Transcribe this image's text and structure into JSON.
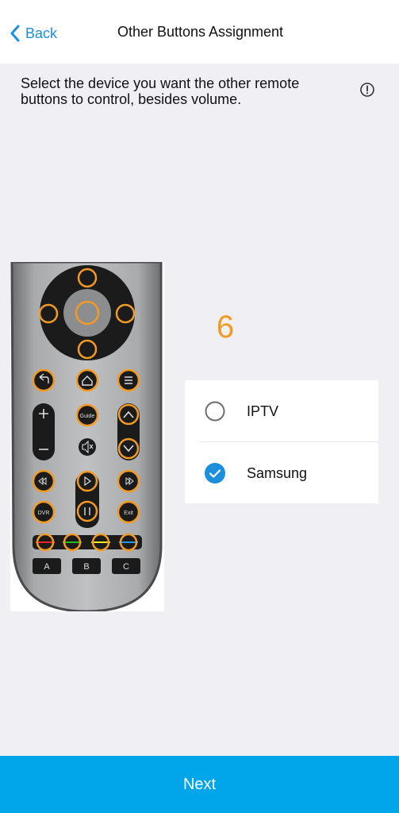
{
  "header": {
    "back_label": "Back",
    "title": "Other Buttons Assignment"
  },
  "instruction": "Select the device you want the other remote buttons to control, besides volume.",
  "step_number": "6",
  "remote": {
    "guide_label": "Guide",
    "dvr_label": "DVR",
    "exit_label": "Exit",
    "a_label": "A",
    "b_label": "B",
    "c_label": "C",
    "highlight_color": "#f39a25"
  },
  "devices": [
    {
      "label": "IPTV",
      "selected": false
    },
    {
      "label": "Samsung",
      "selected": true
    }
  ],
  "footer": {
    "next_label": "Next"
  },
  "colors": {
    "accent": "#1c8fdc",
    "next_button": "#01a6ea",
    "step": "#f39a25",
    "background": "#efeff4"
  }
}
